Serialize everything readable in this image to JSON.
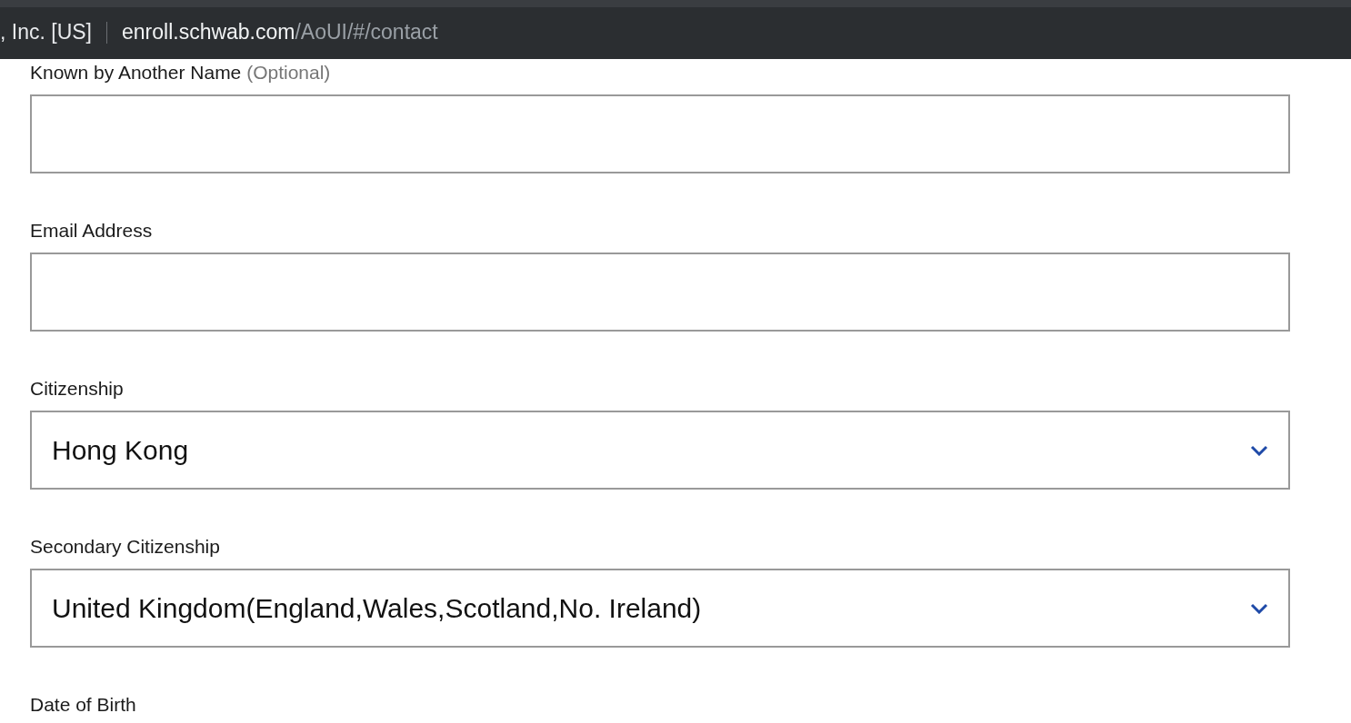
{
  "address_bar": {
    "site_identity": ", Inc. [US]",
    "host": "enroll.schwab.com",
    "path": "/AoUI/#/contact"
  },
  "fields": [
    {
      "kind": "text",
      "label": "Known by Another Name",
      "note": "(Optional)"
    },
    {
      "kind": "text",
      "label": "Email Address"
    },
    {
      "kind": "select",
      "label": "Citizenship",
      "value": "Hong Kong"
    },
    {
      "kind": "select",
      "label": "Secondary Citizenship",
      "value": "United Kingdom(England,Wales,Scotland,No. Ireland)"
    },
    {
      "kind": "heading",
      "label": "Date of Birth"
    }
  ]
}
